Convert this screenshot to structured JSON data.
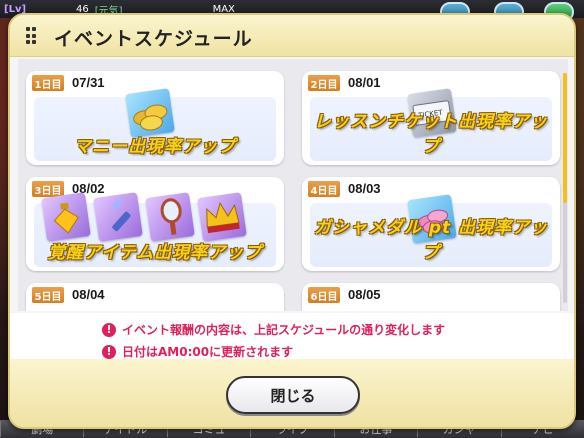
{
  "hud": {
    "lv_label": "[Lv]",
    "level": "46",
    "genki": "[元気]",
    "max_label": "MAX",
    "bottom_tabs": [
      "劇場",
      "アイドル",
      "コミュ",
      "ライブ",
      "お仕事",
      "ガシャ",
      "ナビ"
    ]
  },
  "dialog": {
    "title": "イベントスケジュール",
    "close_label": "閉じる",
    "notes": [
      "イベント報酬の内容は、上記スケジュールの通り変化します",
      "日付はAM0:00に更新されます"
    ],
    "warn_icon_glyph": "!"
  },
  "schedule": [
    {
      "day": "1日目",
      "date": "07/31",
      "bonus": "マニー出現率アップ",
      "icons": [
        "coins-icon"
      ]
    },
    {
      "day": "2日目",
      "date": "08/01",
      "bonus": "レッスンチケット出現率アップ",
      "icons": [
        "ticket-icon"
      ]
    },
    {
      "day": "3日目",
      "date": "08/02",
      "bonus": "覚醒アイテム出現率アップ",
      "icons": [
        "perfume-icon",
        "lipstick-icon",
        "hand-mirror-icon",
        "crown-icon"
      ]
    },
    {
      "day": "4日目",
      "date": "08/03",
      "bonus": "ガシャメダル pt 出現率アップ",
      "icons": [
        "medal-icon"
      ]
    },
    {
      "day": "5日目",
      "date": "08/04",
      "bonus": "",
      "icons": []
    },
    {
      "day": "6日目",
      "date": "08/05",
      "bonus": "",
      "icons": []
    }
  ],
  "colors": {
    "accent_gold": "#f7d21b",
    "warning_red": "#e0205a",
    "day_badge": "#d57f1f"
  }
}
